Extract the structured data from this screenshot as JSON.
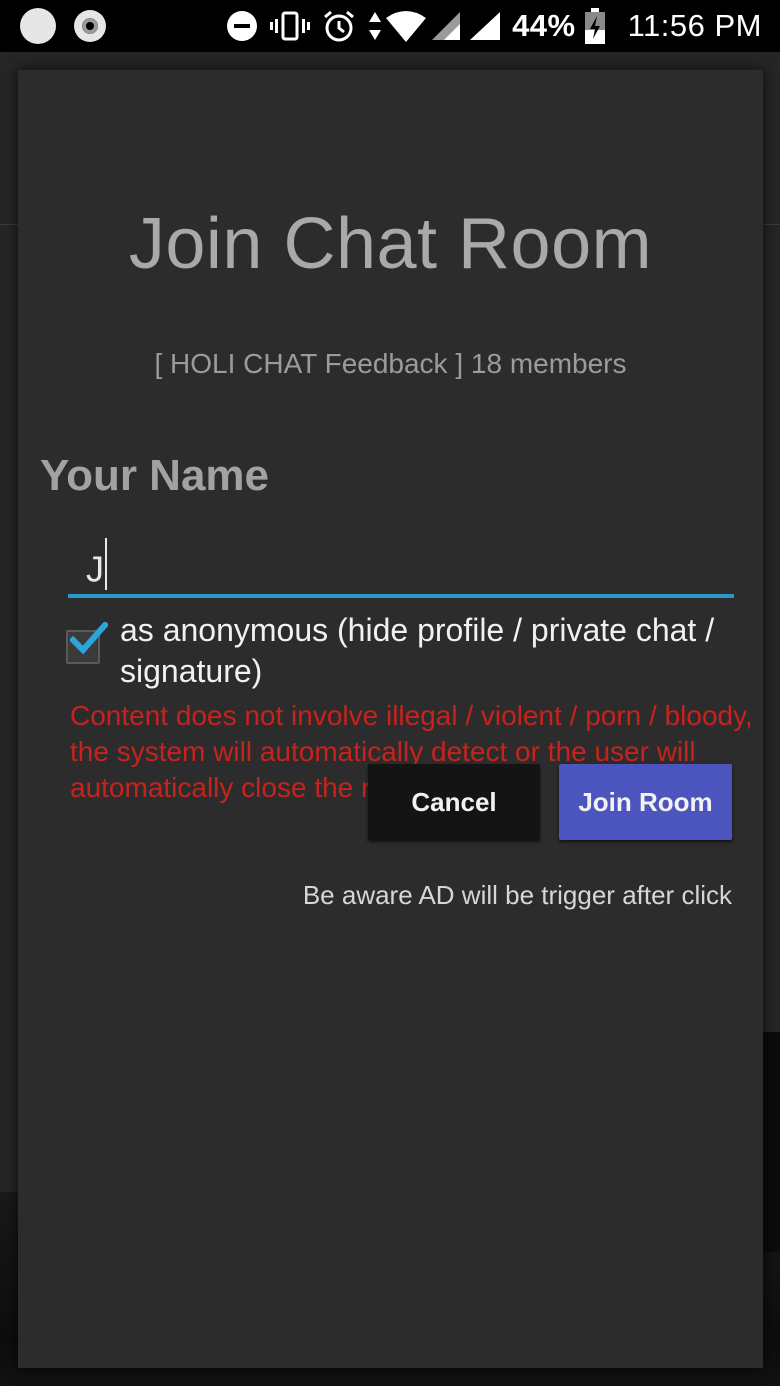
{
  "status_bar": {
    "battery_percent": "44%",
    "time": "11:56 PM",
    "icons": [
      "dnd-icon",
      "vibrate-icon",
      "alarm-icon",
      "data-arrows-icon",
      "wifi-icon",
      "signal-icon",
      "signal-icon",
      "battery-charging-icon"
    ]
  },
  "dialog": {
    "title": "Join Chat Room",
    "room_info": "[ HOLI CHAT Feedback ] 18 members",
    "name_label": "Your Name",
    "name_value": "J",
    "anonymous": {
      "checked": true,
      "label": "as anonymous (hide profile / private chat / signature)"
    },
    "warning": "Content does not involve illegal / violent / porn / bloody, the system will automatically detect or the user will automatically close the report",
    "buttons": {
      "cancel": "Cancel",
      "join": "Join Room"
    },
    "ad_note": "Be aware AD will be trigger after click"
  },
  "colors": {
    "accent": "#2a97c9",
    "primary_button": "#4b55bd",
    "warning": "#c7221d",
    "dialog_bg": "#2c2c2c"
  }
}
